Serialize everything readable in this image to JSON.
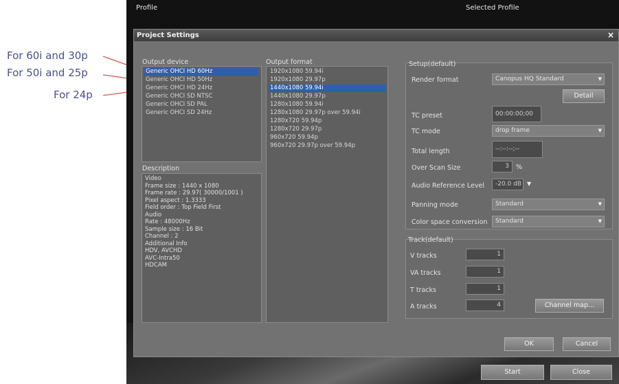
{
  "callouts": [
    {
      "text": "For 60i and 30p"
    },
    {
      "text": "For 50i and 25p"
    },
    {
      "text": "For 24p"
    }
  ],
  "topbar": {
    "left_label": "Profile",
    "right_label": "Selected Profile"
  },
  "dialog": {
    "title": "Project Settings",
    "close_symbol": "×"
  },
  "output_device": {
    "header": "Output device",
    "items": [
      {
        "label": "Generic OHCI HD 60Hz",
        "selected": true
      },
      {
        "label": "Generic OHCI HD 50Hz",
        "selected": false
      },
      {
        "label": "Generic OHCI HD 24Hz",
        "selected": false
      },
      {
        "label": "Generic OHCI SD NTSC",
        "selected": false
      },
      {
        "label": "Generic OHCI SD PAL",
        "selected": false
      },
      {
        "label": "Generic OHCI SD 24Hz",
        "selected": false
      }
    ]
  },
  "output_format": {
    "header": "Output format",
    "items": [
      {
        "label": "1920x1080 59.94i",
        "selected": false
      },
      {
        "label": "1920x1080 29.97p",
        "selected": false
      },
      {
        "label": "1440x1080 59.94i",
        "selected": true
      },
      {
        "label": "1440x1080 29.97p",
        "selected": false
      },
      {
        "label": "1280x1080 59.94i",
        "selected": false
      },
      {
        "label": "1280x1080 29.97p over 59.94i",
        "selected": false
      },
      {
        "label": "1280x720 59.94p",
        "selected": false
      },
      {
        "label": "1280x720 29.97p",
        "selected": false
      },
      {
        "label": "960x720 59.94p",
        "selected": false
      },
      {
        "label": "960x720 29.97p over 59.94p",
        "selected": false
      }
    ]
  },
  "description": {
    "header": "Description",
    "lines": [
      "Video",
      "Frame size : 1440 x 1080",
      "Frame rate : 29.97( 30000/1001 )",
      "Pixel aspect : 1.3333",
      "Field order : Top Field First",
      "Audio",
      "Rate : 48000Hz",
      "Sample size : 16 Bit",
      "Channel : 2",
      "Additional Info",
      "HDV, AVCHD",
      "AVC-Intra50",
      "HDCAM"
    ]
  },
  "setup": {
    "header": "Setup(default)",
    "render_format_label": "Render format",
    "render_format_value": "Canopus HQ Standard",
    "detail_button": "Detail",
    "tc_preset_label": "TC preset",
    "tc_preset_value": "00:00:00;00",
    "tc_mode_label": "TC mode",
    "tc_mode_value": "drop frame",
    "total_length_label": "Total length",
    "total_length_value": "--:--:--;--",
    "over_scan_label": "Over Scan Size",
    "over_scan_value": "3",
    "over_scan_unit": "%",
    "audio_ref_label": "Audio Reference Level",
    "audio_ref_value": "-20.0 dB",
    "panning_label": "Panning mode",
    "panning_value": "Standard",
    "color_space_label": "Color space conversion",
    "color_space_value": "Standard"
  },
  "track": {
    "header": "Track(default)",
    "v_label": "V tracks",
    "v_value": "1",
    "va_label": "VA tracks",
    "va_value": "1",
    "t_label": "T tracks",
    "t_value": "1",
    "a_label": "A tracks",
    "a_value": "4",
    "channel_map_button": "Channel map..."
  },
  "buttons": {
    "ok": "OK",
    "cancel": "Cancel",
    "start": "Start",
    "close": "Close"
  },
  "colors": {
    "selection": "#2e5faa",
    "callout": "#4a4f8c",
    "callout_line": "#d9534f"
  },
  "icons": {
    "dropdown": "chevron-down-icon",
    "close": "close-icon"
  }
}
